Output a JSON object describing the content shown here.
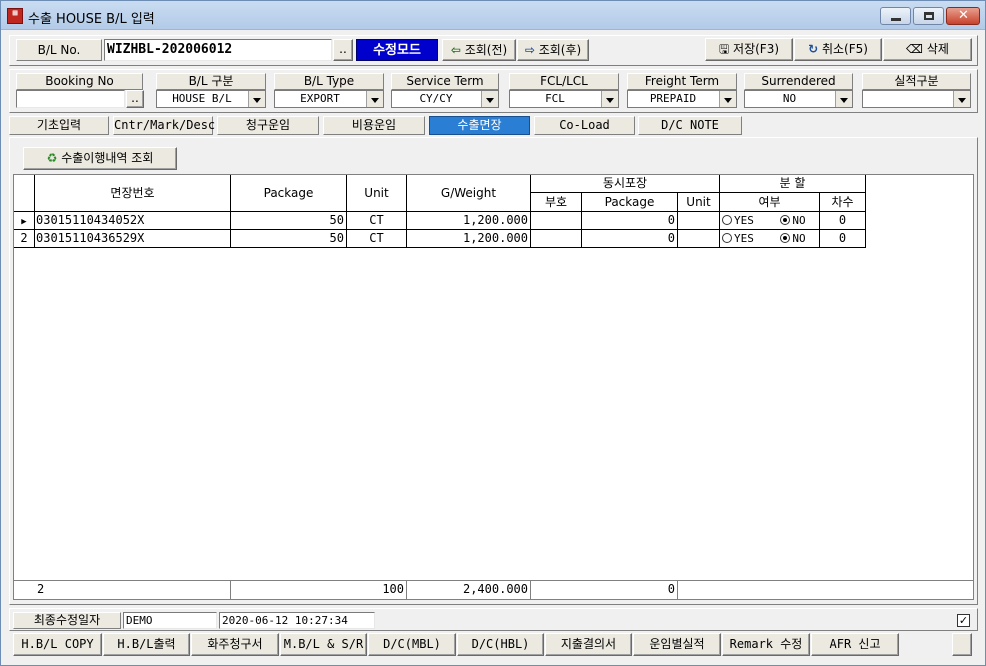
{
  "window": {
    "title": "수출 HOUSE B/L 입력",
    "icon_text": "E"
  },
  "header": {
    "bl_label": "B/L No.",
    "bl_value": "WIZHBL-202006012",
    "dots": "..",
    "mode": "수정모드",
    "prev": "조회(전)",
    "next": "조회(후)",
    "save": "저장(F3)",
    "cancel": "취소(F5)",
    "delete": "삭제"
  },
  "filters": [
    {
      "label": "Booking No",
      "value": ""
    },
    {
      "label": "B/L 구분",
      "value": "HOUSE B/L"
    },
    {
      "label": "B/L Type",
      "value": "EXPORT"
    },
    {
      "label": "Service Term",
      "value": "CY/CY"
    },
    {
      "label": "FCL/LCL",
      "value": "FCL"
    },
    {
      "label": "Freight Term",
      "value": "PREPAID"
    },
    {
      "label": "Surrendered",
      "value": "NO"
    },
    {
      "label": "실적구분",
      "value": ""
    }
  ],
  "tabs": [
    "기초입력",
    "Cntr/Mark/Desc",
    "청구운임",
    "비용운임",
    "수출면장",
    "Co-Load",
    "D/C NOTE"
  ],
  "history_button": "수출이행내역 조회",
  "grid": {
    "headers": {
      "license_no": "면장번호",
      "package": "Package",
      "unit": "Unit",
      "gweight": "G/Weight",
      "simul": "동시포장",
      "sym": "부호",
      "spkg": "Package",
      "sunit": "Unit",
      "split": "분 할",
      "yesno": "여부",
      "seq": "차수"
    },
    "rows": [
      {
        "num": "",
        "license_no": "03015110434052X",
        "package": "50",
        "unit": "CT",
        "gweight": "1,200.000",
        "sym": "",
        "spkg": "0",
        "sunit": "",
        "yes": "YES",
        "no": "NO",
        "seq": "0"
      },
      {
        "num": "2",
        "license_no": "03015110436529X",
        "package": "50",
        "unit": "CT",
        "gweight": "1,200.000",
        "sym": "",
        "spkg": "0",
        "sunit": "",
        "yes": "YES",
        "no": "NO",
        "seq": "0"
      }
    ],
    "footer": {
      "count": "2",
      "package": "100",
      "gweight": "2,400.000",
      "spkg": "0"
    }
  },
  "status": {
    "label": "최종수정일자",
    "user": "DEMO",
    "datetime": "2020-06-12 10:27:34"
  },
  "bottom_buttons": [
    "H.B/L COPY",
    "H.B/L출력",
    "화주청구서",
    "M.B/L & S/R",
    "D/C(MBL)",
    "D/C(HBL)",
    "지출결의서",
    "운임별실적",
    "Remark 수정",
    "AFR 신고"
  ]
}
